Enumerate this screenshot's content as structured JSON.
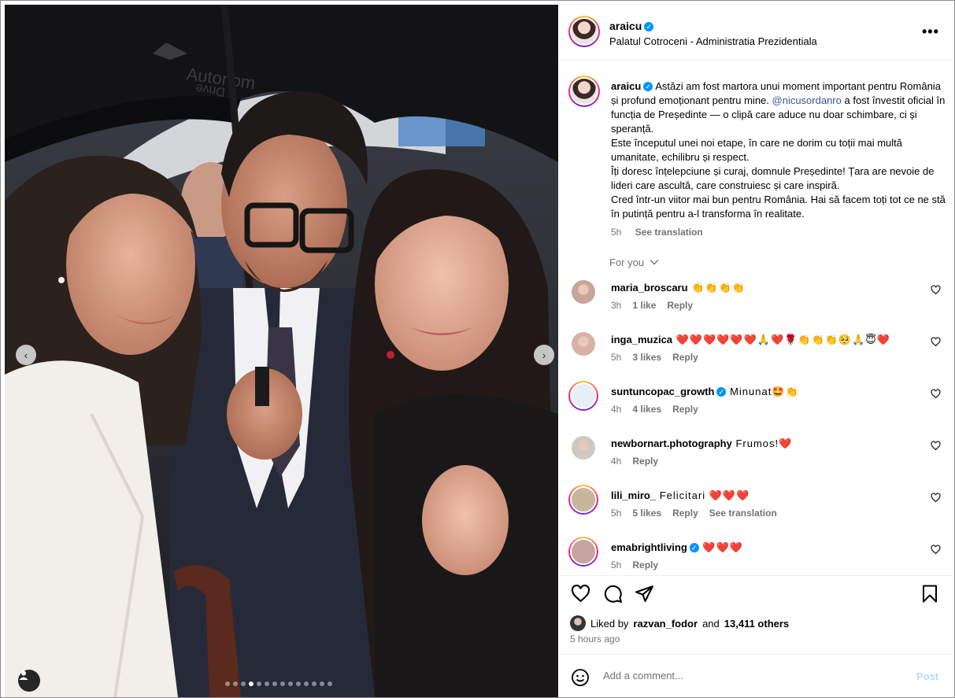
{
  "post": {
    "username": "araicu",
    "location": "Palatul Cotroceni - Administratia Prezidentiala",
    "caption_username": "araicu",
    "caption_part1": " Astăzi am fost martora unui moment important pentru România și profund emoționant pentru mine. ",
    "caption_mention": "@nicusordanro",
    "caption_part2": " a fost învestit oficial în funcția de Președinte — o clipă care aduce nu doar schimbare, ci și speranță.",
    "caption_line2": "Este începutul unei noi etape, în care ne dorim cu toții mai multă umanitate, echilibru și respect.",
    "caption_line3": "Îți doresc înțelepciune și curaj, domnule Președinte! Țara are nevoie de lideri care ascultă, care construiesc și care inspiră.",
    "caption_line4": "Cred într-un viitor mai bun pentru România. Hai să facem toți tot ce ne stă în putință pentru a-l transforma în realitate.",
    "caption_time": "5h",
    "see_translation": "See translation",
    "for_you": "For you",
    "more_glyph": "•••"
  },
  "photo": {
    "umbrella_text_top": "Autonom",
    "umbrella_text_bottom": "Drive",
    "dot_count": 14,
    "active_dot": 3
  },
  "comments": [
    {
      "user": "maria_broscaru",
      "verified": false,
      "text": " 👏👏👏👏",
      "time": "3h",
      "likes": "1 like",
      "reply": "Reply",
      "translate": ""
    },
    {
      "user": "inga_muzica",
      "verified": false,
      "text": " ❤️❤️❤️❤️❤️❤️🙏❤️🌹👏👏👏🥺🙏😇❤️",
      "time": "5h",
      "likes": "3 likes",
      "reply": "Reply",
      "translate": ""
    },
    {
      "user": "suntuncopac_growth",
      "verified": true,
      "text": " Minunat🤩👏",
      "time": "4h",
      "likes": "4 likes",
      "reply": "Reply",
      "translate": ""
    },
    {
      "user": "newbornart.photography",
      "verified": false,
      "text": " Frumos!❤️",
      "time": "4h",
      "likes": "",
      "reply": "Reply",
      "translate": ""
    },
    {
      "user": "lili_miro_",
      "verified": false,
      "text": " Felicitari ❤️❤️❤️",
      "time": "5h",
      "likes": "5 likes",
      "reply": "Reply",
      "translate": "See translation"
    },
    {
      "user": "emabrightliving",
      "verified": true,
      "text": " ❤️❤️❤️",
      "time": "5h",
      "likes": "",
      "reply": "Reply",
      "translate": ""
    }
  ],
  "likes": {
    "prefix": "Liked by",
    "user": "razvan_fodor",
    "and": "and",
    "others": "13,411 others"
  },
  "posted_ago": "5 hours ago",
  "add_comment": {
    "placeholder": "Add a comment...",
    "post_label": "Post"
  },
  "colors": {
    "verified": "#0095f6",
    "mention": "#385898",
    "post_disabled": "#b3dbff",
    "muted": "#737373"
  }
}
